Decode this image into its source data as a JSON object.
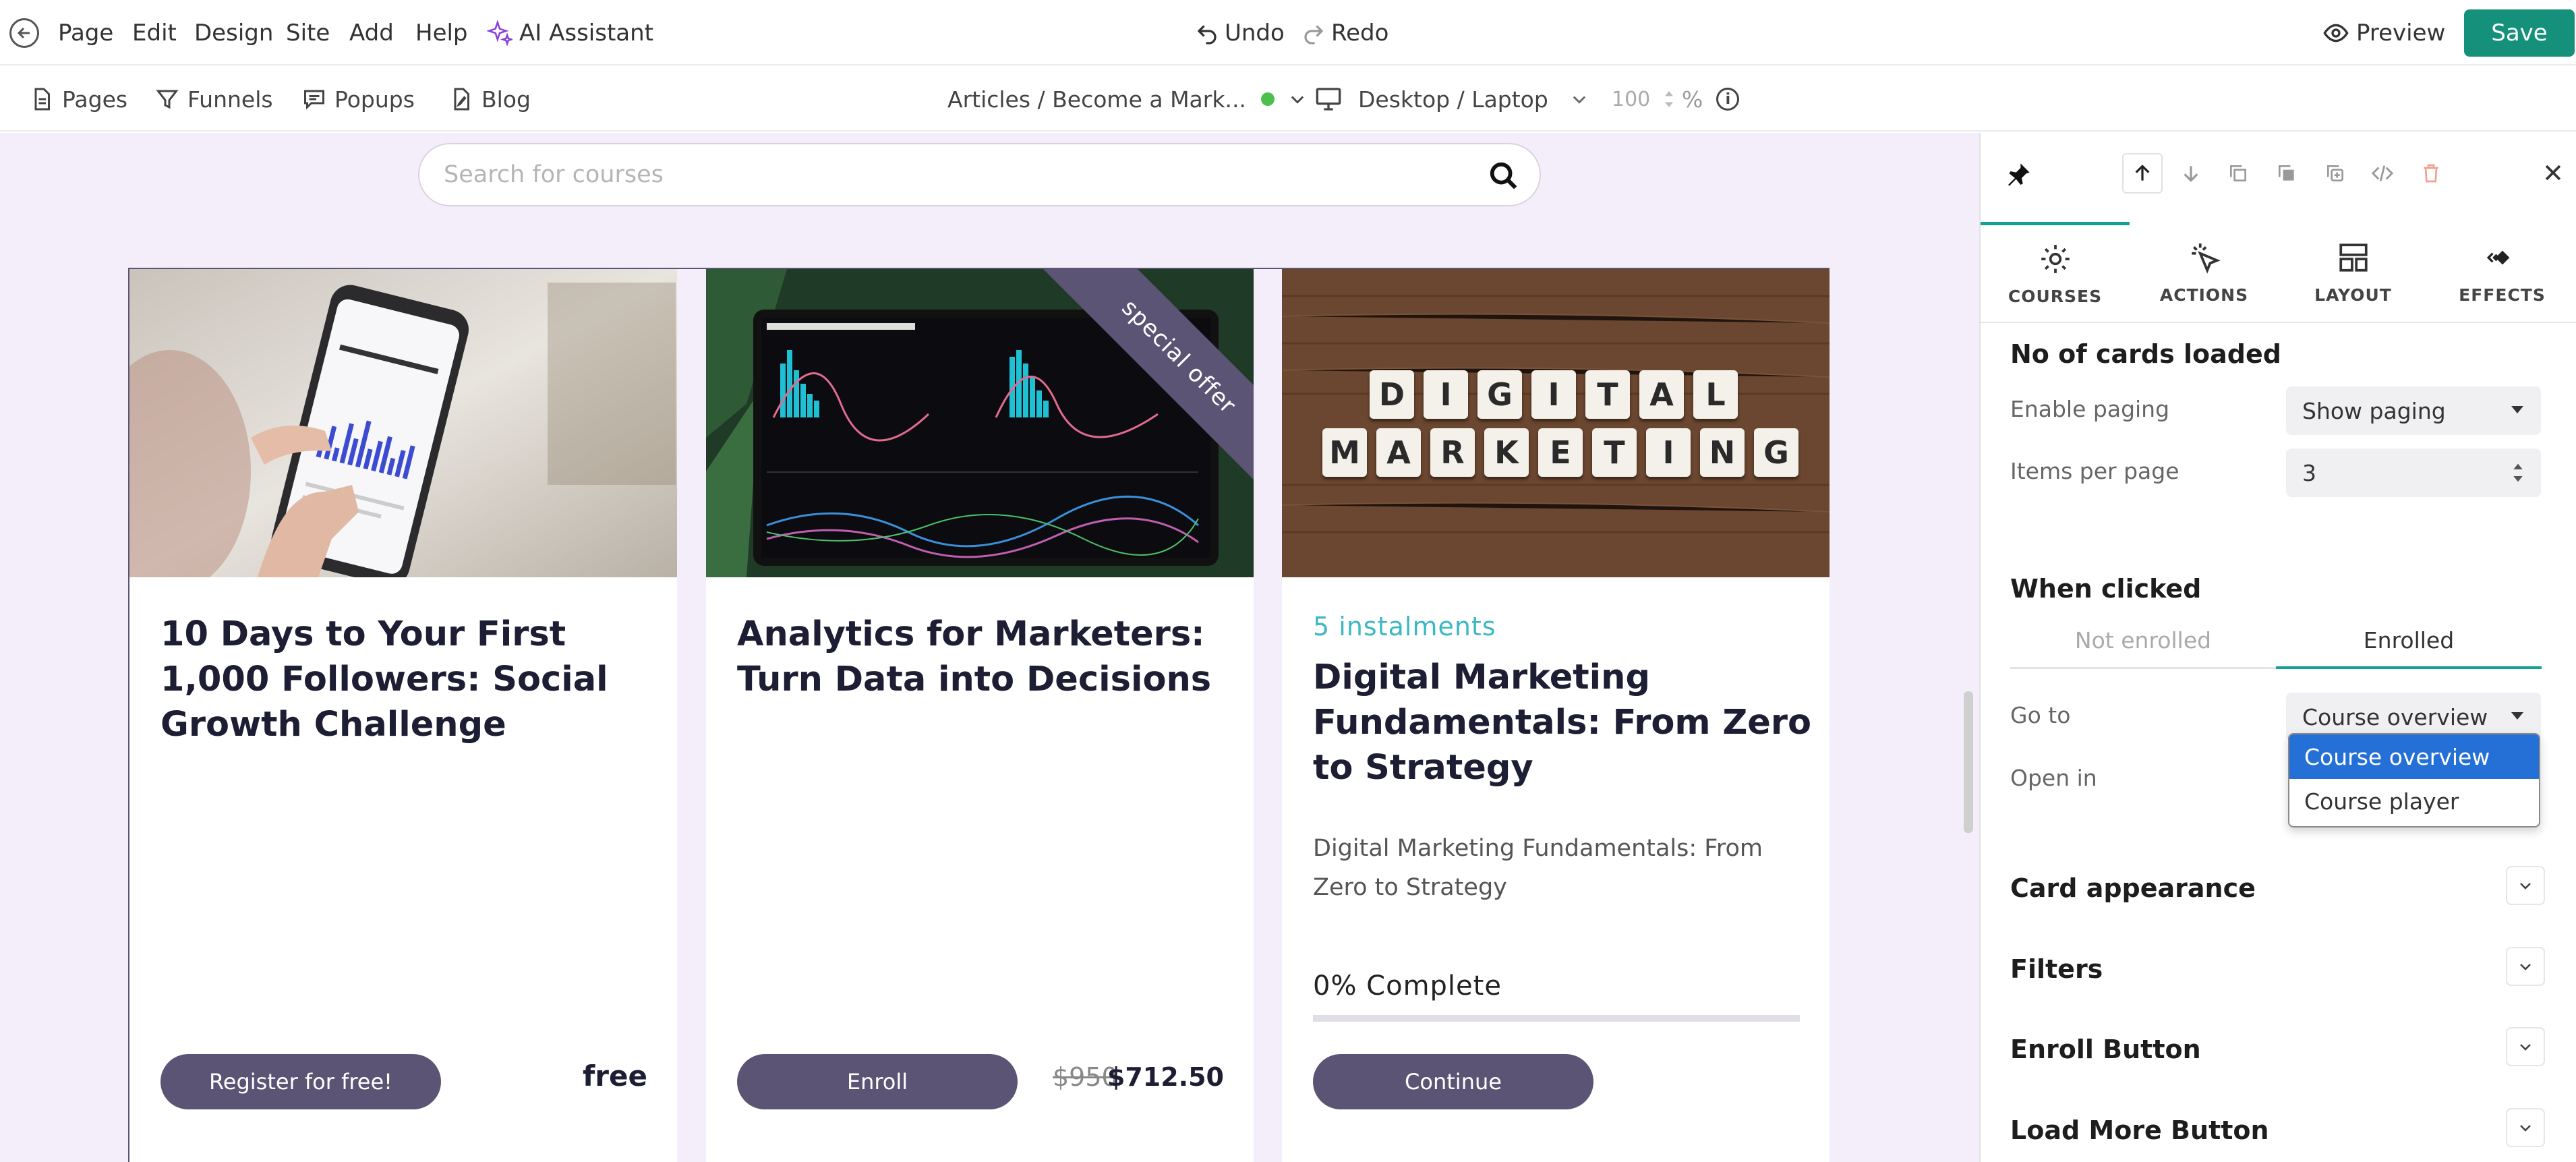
{
  "menu": {
    "page": "Page",
    "edit": "Edit",
    "design": "Design",
    "site": "Site",
    "add": "Add",
    "help": "Help",
    "ai_assistant": "AI Assistant",
    "undo": "Undo",
    "redo": "Redo",
    "preview": "Preview",
    "save": "Save"
  },
  "toolbar": {
    "pages": "Pages",
    "funnels": "Funnels",
    "popups": "Popups",
    "blog": "Blog",
    "breadcrumb": "Articles / Become a Mark...",
    "device": "Desktop / Laptop",
    "zoom": "100",
    "zoom_unit": "%"
  },
  "canvas": {
    "search_placeholder": "Search for courses",
    "cards": [
      {
        "title": "10 Days to Your First 1,000 Followers: Social Growth Challenge",
        "button": "Register for free!",
        "price": "free"
      },
      {
        "title": "Analytics for Marketers: Turn Data into Decisions",
        "ribbon": "special offer",
        "button": "Enroll",
        "old_price": "$950",
        "price": "$712.50"
      },
      {
        "instalments": "5 instalments",
        "title": "Digital Marketing Fundamentals: From Zero to Strategy",
        "description": "Digital Marketing Fundamentals: From Zero to Strategy",
        "progress_label": "0% Complete",
        "progress": 0,
        "button": "Continue",
        "image_text": [
          "DIGITAL",
          "MARKETING"
        ]
      }
    ]
  },
  "panel": {
    "tabs": [
      "COURSES",
      "ACTIONS",
      "LAYOUT",
      "EFFECTS"
    ],
    "no_cards_heading": "No of cards loaded",
    "enable_paging_label": "Enable paging",
    "enable_paging_value": "Show paging",
    "items_per_page_label": "Items per page",
    "items_per_page_value": "3",
    "when_clicked_heading": "When clicked",
    "segment_not_enrolled": "Not enrolled",
    "segment_enrolled": "Enrolled",
    "go_to_label": "Go to",
    "go_to_value": "Course overview",
    "open_in_label": "Open in",
    "dropdown_options": [
      "Course overview",
      "Course player"
    ],
    "sections": [
      "Card appearance",
      "Filters",
      "Enroll Button",
      "Load More Button"
    ]
  },
  "colors": {
    "accent": "#15907a",
    "card_button": "#5b5474",
    "ai": "#8b3fd9",
    "instalments": "#3db8c2",
    "selected_option": "#2470d7"
  }
}
